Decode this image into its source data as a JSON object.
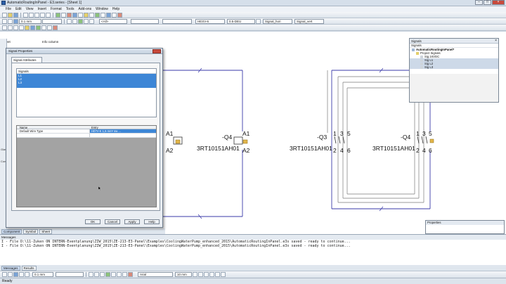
{
  "window": {
    "title": "AutomaticRoutingInPanel - E3.series - [Sheet 1]"
  },
  "menu": [
    "File",
    "Edit",
    "View",
    "Insert",
    "Format",
    "Tools",
    "Add-ons",
    "Window",
    "Help"
  ],
  "toolbar": {
    "line_width": "0.1 mm",
    "field_a": "<All>",
    "field_b": "HESV-6",
    "field_c": "0.5-DEU",
    "field_d": "Signal_hori",
    "field_e": "Signal_vert"
  },
  "sheet_header": {
    "sheet": "Sheet",
    "info_column": "Info column"
  },
  "left_panel": [
    "Glas",
    "Conn"
  ],
  "bottom_tabs": [
    "Component",
    "Symbol",
    "Sheet"
  ],
  "dialog": {
    "title": "Signal Properties",
    "tab": "Signal Attributes",
    "signals_header": "Signals",
    "signals": [
      "L1",
      "L2",
      "L3"
    ],
    "attr_columns": {
      "name": "Name",
      "entry": "Entry"
    },
    "attr_rows": [
      {
        "name": "Default Wire Type",
        "entry": "H07V-K 1,5 mm² sw ..."
      }
    ],
    "buttons": {
      "ok": "OK",
      "cancel": "Cancel",
      "apply": "Apply",
      "help": "Help"
    }
  },
  "schematic": {
    "devices": [
      {
        "id": "-Q4",
        "type": "3RT10151AH01",
        "pins_top": [
          "A1"
        ],
        "pins_bottom": [
          "A2"
        ]
      },
      {
        "id": "-Q4",
        "type": "3RT10151AH01",
        "pins_top": [
          "A1"
        ],
        "pins_bottom": [
          "A2"
        ]
      },
      {
        "id": "-Q3",
        "type": "3RT10151AH01",
        "pins_top": [
          "1",
          "3",
          "5"
        ],
        "pins_bottom": [
          "2",
          "4",
          "6"
        ]
      },
      {
        "id": "-Q4",
        "type": "3RT10151AH01",
        "pins_top": [
          "1",
          "3",
          "5"
        ],
        "pins_bottom": [
          "2",
          "4",
          "6"
        ]
      }
    ]
  },
  "signals_window": {
    "title": "Signals",
    "subtitle": "Signals",
    "tree": [
      {
        "label": "AutomaticRoutingInPanel*",
        "level": 0
      },
      {
        "label": "Project Signals",
        "level": 1
      },
      {
        "label": "Sig 24VDC",
        "level": 2
      },
      {
        "label": "Sig L1",
        "level": 2
      },
      {
        "label": "Sig L2",
        "level": 2
      },
      {
        "label": "Sig L3",
        "level": 2
      }
    ]
  },
  "properties_window": {
    "title": "Properties"
  },
  "messages": {
    "header": "Messages",
    "lines": [
      "I - File D:\\11-Zuken ON INTERN-Eventplanung\\ZIW_2015\\ZE-213-E3-Panel\\Examples\\CoolingWaterPump_enhanced_2015\\AutomaticRoutingInPanel.e3s saved  - ready to continue...",
      "I - File D:\\11-Zuken ON INTERN-Eventplanung\\ZIW_2015\\ZE-213-E3-Panel\\Examples\\CoolingWaterPump_enhanced_2015\\AutomaticRoutingInPanel.e3s saved  - ready to continue..."
    ]
  },
  "message_tabs": [
    "Messages",
    "Results"
  ],
  "bottom_toolbar": {
    "line_width": "0.1 mm",
    "font": "Arial",
    "font_size": "10 mm"
  },
  "status": "Ready",
  "colors": {
    "selection": "#3d86d6",
    "schematic_blue": "#3a3aa8",
    "wire_gray": "#7a7a7a"
  }
}
